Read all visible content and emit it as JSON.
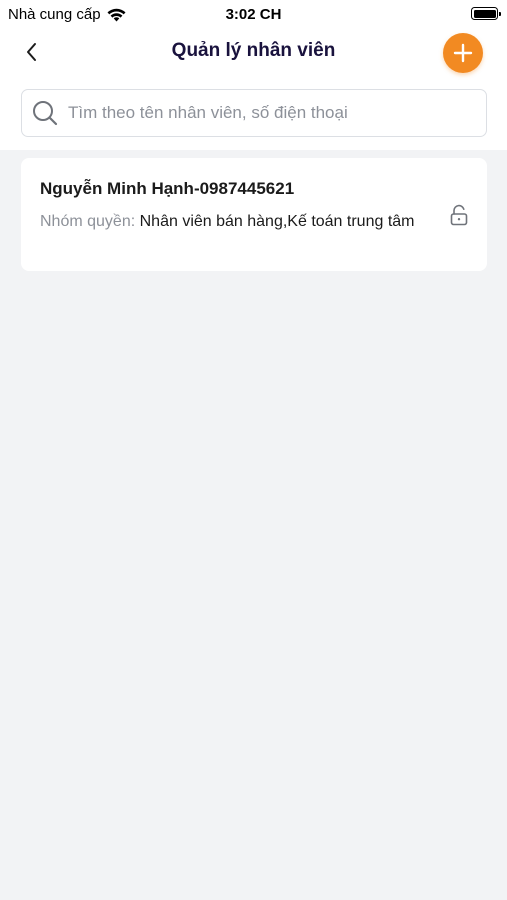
{
  "status_bar": {
    "carrier": "Nhà cung cấp",
    "time": "3:02 CH",
    "icons": [
      "wifi-icon",
      "battery-icon"
    ]
  },
  "header": {
    "title": "Quản lý nhân viên",
    "back_icon": "chevron-left-icon",
    "add_icon": "plus-icon"
  },
  "search": {
    "placeholder": "Tìm theo tên nhân viên, số điện thoại",
    "value": "",
    "icon": "search-icon"
  },
  "employees": [
    {
      "name": "Nguyễn Minh Hạnh-0987445621",
      "role_label": "Nhóm quyền:",
      "roles": "Nhân viên bán hàng,Kế toán trung tâm",
      "icon": "lock-open-icon"
    }
  ],
  "colors": {
    "accent": "#f28a22",
    "title": "#19123d",
    "background": "#f2f3f5",
    "muted": "#8d9199"
  }
}
